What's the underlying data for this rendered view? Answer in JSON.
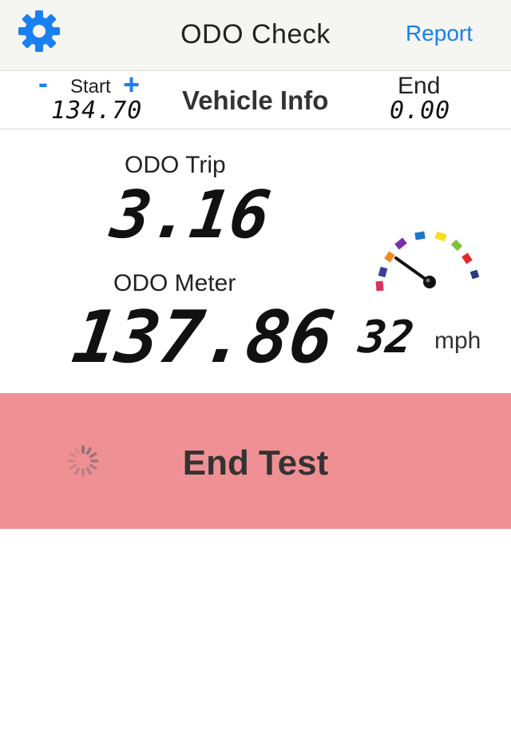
{
  "nav": {
    "title": "ODO Check",
    "report_label": "Report",
    "settings_icon": "gear-icon"
  },
  "vehicle": {
    "start_label": "Start",
    "start_value": "134.70",
    "minus_label": "-",
    "plus_label": "+",
    "title": "Vehicle Info",
    "end_label": "End",
    "end_value": "0.00"
  },
  "readings": {
    "trip_label": "ODO Trip",
    "trip_value": "3.16",
    "meter_label": "ODO Meter",
    "meter_value": "137.86",
    "speed_value": "32",
    "speed_unit": "mph",
    "gauge_icon": "speedometer-icon"
  },
  "action": {
    "end_test_label": "End Test",
    "spinner_icon": "activity-spinner-icon"
  },
  "colors": {
    "accent": "#1a7ff0",
    "end_button_bg": "#ef9094",
    "nav_bg": "#f5f6f2"
  }
}
